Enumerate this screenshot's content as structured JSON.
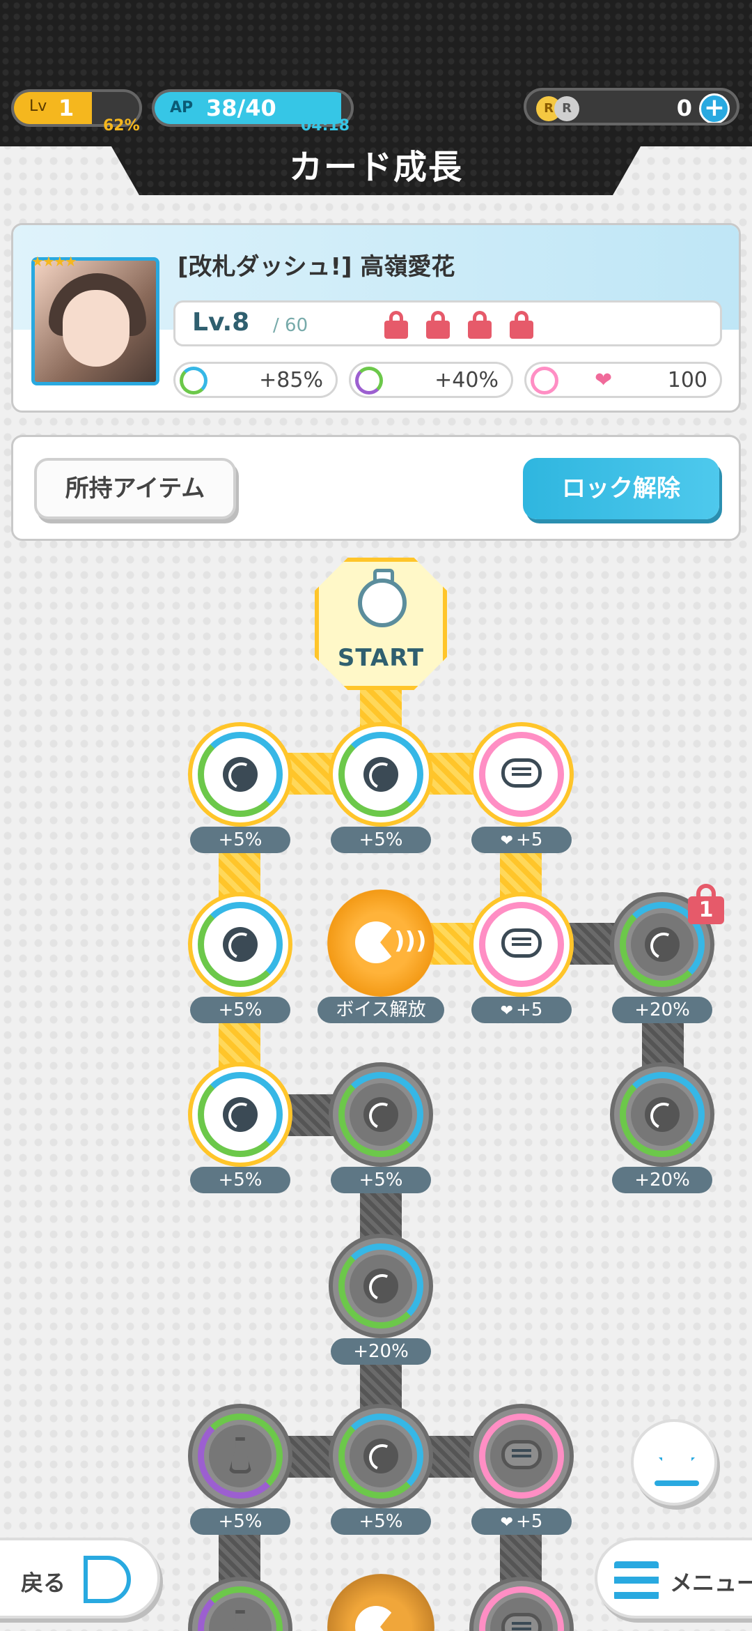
{
  "header": {
    "title": "カード成長",
    "level_label": "Lv",
    "level_value": "1",
    "level_progress": "62%",
    "level_progress_fraction": 0.62,
    "ap_label": "AP",
    "ap_value": "38/40",
    "ap_fraction": 0.95,
    "ap_timer": "04:18",
    "coin_icons": [
      "R",
      "R"
    ],
    "coin_value": "0",
    "add_label": "+"
  },
  "card": {
    "rarity_stars": "★★★★",
    "name": "[改札ダッシュ!] 高嶺愛花",
    "level": "Lv.8",
    "level_max": "/ 60",
    "stats": [
      {
        "icon": "tennis-ball-icon",
        "value": "+85%"
      },
      {
        "icon": "flask-icon",
        "value": "+40%"
      },
      {
        "icon": "chat-bubble-icon",
        "value": "100"
      }
    ]
  },
  "actions": {
    "items_label": "所持アイテム",
    "unlock_label": "ロック解除"
  },
  "tree": {
    "start_label": "START",
    "lock_count": "1",
    "labels": {
      "n1": "+5%",
      "n2": "+5%",
      "n3": "+5",
      "n4": "+5%",
      "voice": "ボイス解放",
      "n5": "+5",
      "n6": "+20%",
      "n7": "+5%",
      "n8": "+5%",
      "n9": "+20%",
      "n10": "+20%",
      "n11": "+5%",
      "n12": "+5%",
      "n13": "+5"
    }
  },
  "footer": {
    "back_label": "戻る",
    "menu_label": "メニュー"
  },
  "colors": {
    "gold": "#ffc52a",
    "blue": "#29a9e0",
    "green": "#6cc84a",
    "pink": "#ff8ec4",
    "purple": "#9c5fd0",
    "lock_red": "#e65a6a"
  }
}
